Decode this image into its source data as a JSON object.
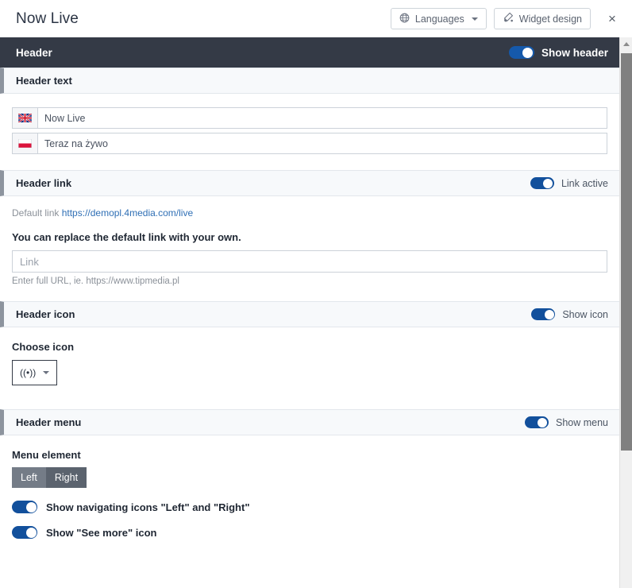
{
  "window": {
    "title": "Now Live",
    "languages_button": "Languages",
    "widget_design_button": "Widget design",
    "close_label": "×"
  },
  "header_section": {
    "title": "Header",
    "toggle_label": "Show header",
    "toggle_on": true
  },
  "header_text": {
    "title": "Header text",
    "rows": [
      {
        "flag": "uk-flag-icon",
        "value": "Now Live"
      },
      {
        "flag": "poland-flag-icon",
        "value": "Teraz na żywo"
      }
    ]
  },
  "header_link": {
    "title": "Header link",
    "toggle_label": "Link active",
    "toggle_on": true,
    "default_link_prefix": "Default link",
    "default_link_url": "https://demopl.4media.com/live",
    "replace_text": "You can replace the default link with your own.",
    "link_placeholder": "Link",
    "link_value": "",
    "hint": "Enter full URL, ie. https://www.tipmedia.pl"
  },
  "header_icon": {
    "title": "Header icon",
    "toggle_label": "Show icon",
    "toggle_on": true,
    "choose_label": "Choose icon",
    "selected_icon": "((•))"
  },
  "header_menu": {
    "title": "Header menu",
    "toggle_label": "Show menu",
    "toggle_on": true,
    "menu_element_label": "Menu element",
    "options": [
      {
        "label": "Left",
        "active": false
      },
      {
        "label": "Right",
        "active": true
      }
    ],
    "switches": [
      {
        "label": "Show navigating icons \"Left\" and \"Right\"",
        "on": true
      },
      {
        "label": "Show \"See more\" icon",
        "on": true
      }
    ]
  },
  "colors": {
    "accent_blue": "#12509c",
    "dark_bar": "#343a46",
    "link_blue": "#2f6fb5"
  }
}
